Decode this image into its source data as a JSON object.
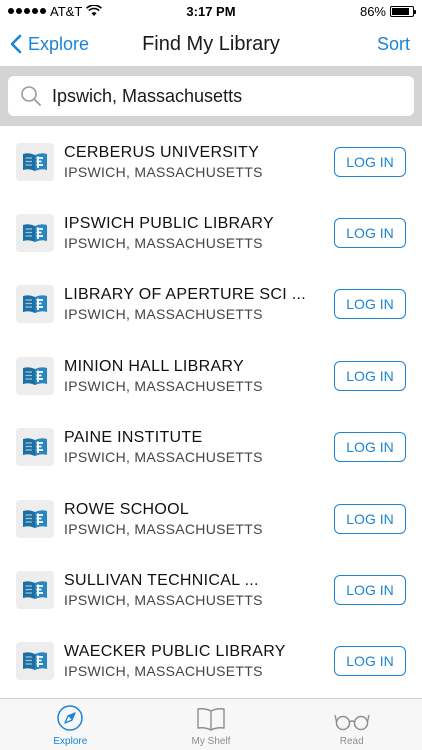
{
  "status_bar": {
    "carrier": "AT&T",
    "time": "3:17 PM",
    "battery_text": "86%",
    "battery_level": 0.86
  },
  "nav": {
    "back_label": "Explore",
    "title": "Find My Library",
    "sort_label": "Sort"
  },
  "search": {
    "value": "Ipswich, Massachusetts"
  },
  "libraries": [
    {
      "name": "CERBERUS UNIVERSITY",
      "location": "IPSWICH, MASSACHUSETTS",
      "action": "LOG IN"
    },
    {
      "name": "IPSWICH PUBLIC LIBRARY",
      "location": "IPSWICH, MASSACHUSETTS",
      "action": "LOG IN"
    },
    {
      "name": "LIBRARY OF APERTURE SCI ...",
      "location": "IPSWICH, MASSACHUSETTS",
      "action": "LOG IN"
    },
    {
      "name": "MINION HALL LIBRARY",
      "location": "IPSWICH, MASSACHUSETTS",
      "action": "LOG IN"
    },
    {
      "name": "PAINE INSTITUTE",
      "location": "IPSWICH, MASSACHUSETTS",
      "action": "LOG IN"
    },
    {
      "name": "ROWE SCHOOL",
      "location": "IPSWICH, MASSACHUSETTS",
      "action": "LOG IN"
    },
    {
      "name": "SULLIVAN TECHNICAL ...",
      "location": "IPSWICH, MASSACHUSETTS",
      "action": "LOG IN"
    },
    {
      "name": "WAECKER PUBLIC LIBRARY",
      "location": "IPSWICH, MASSACHUSETTS",
      "action": "LOG IN"
    }
  ],
  "tabs": [
    {
      "label": "Explore",
      "icon": "compass-icon",
      "active": true
    },
    {
      "label": "My Shelf",
      "icon": "book-icon",
      "active": false
    },
    {
      "label": "Read",
      "icon": "glasses-icon",
      "active": false
    }
  ],
  "colors": {
    "accent": "#1a84d6",
    "logo_blue": "#1b6fa3",
    "search_bg": "#d4d4d4"
  }
}
